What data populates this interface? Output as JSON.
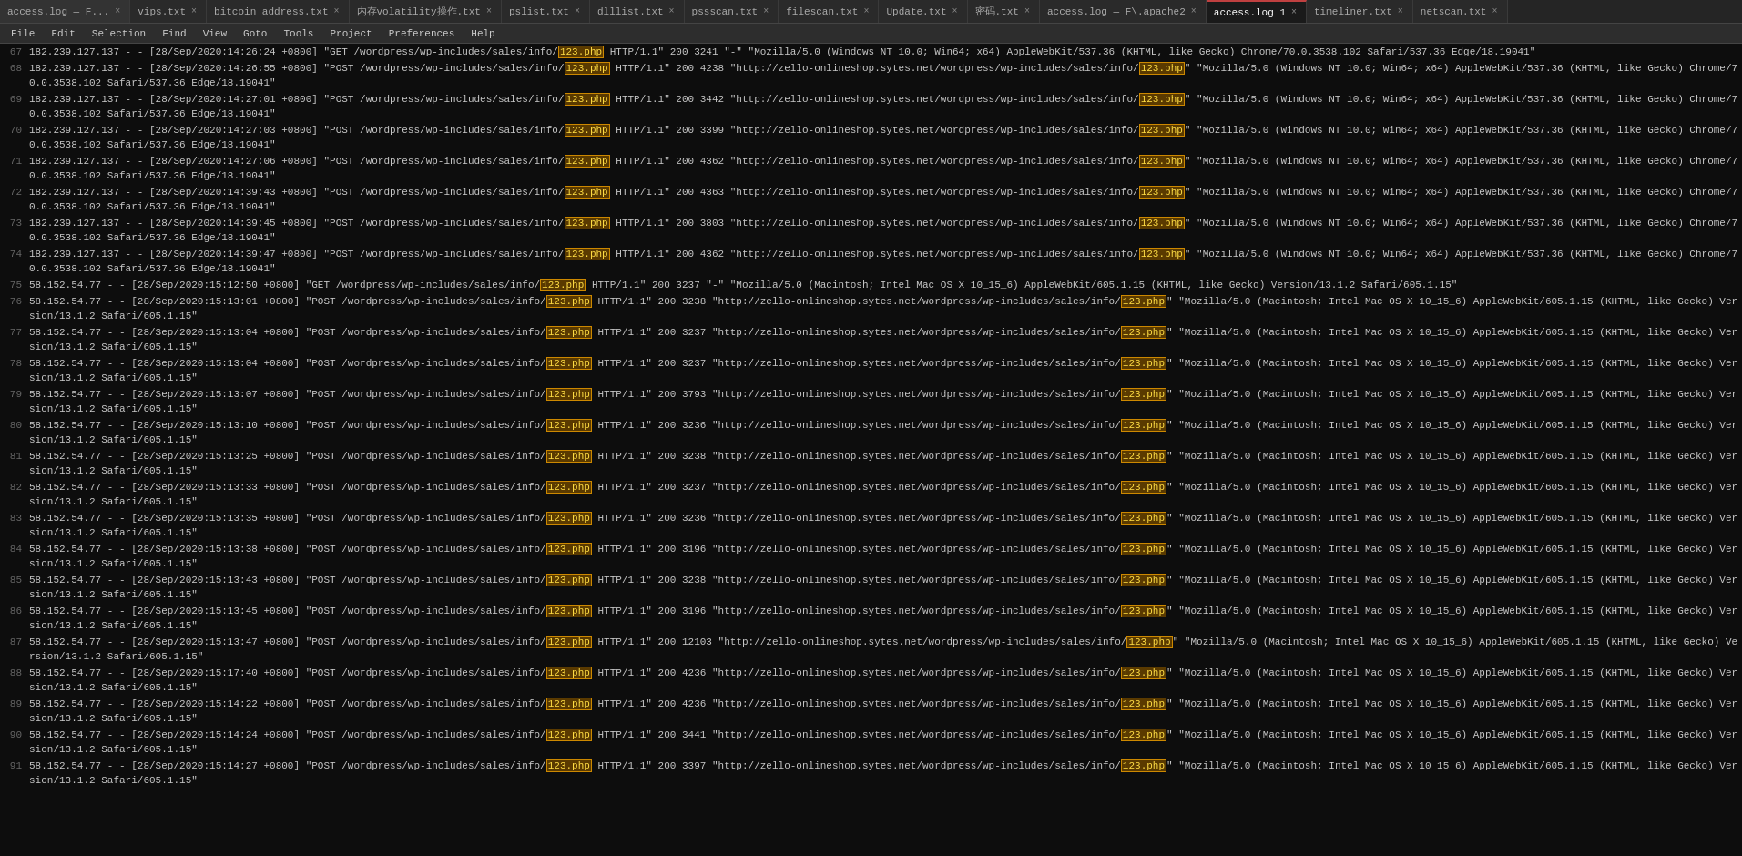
{
  "tabs": [
    {
      "id": "access-log",
      "label": "access.log — F...",
      "active": false,
      "closable": true
    },
    {
      "id": "vips",
      "label": "vips.txt",
      "active": false,
      "closable": true
    },
    {
      "id": "bitcoin",
      "label": "bitcoin_address.txt",
      "active": false,
      "closable": true
    },
    {
      "id": "volatility",
      "label": "内存volatility操作.txt",
      "active": false,
      "closable": true
    },
    {
      "id": "pslist",
      "label": "pslist.txt",
      "active": false,
      "closable": true
    },
    {
      "id": "dlllist",
      "label": "dlllist.txt",
      "active": false,
      "closable": true
    },
    {
      "id": "pssscan",
      "label": "pssscan.txt",
      "active": false,
      "closable": true
    },
    {
      "id": "filescan",
      "label": "filescan.txt",
      "active": false,
      "closable": true
    },
    {
      "id": "update",
      "label": "Update.txt",
      "active": false,
      "closable": true
    },
    {
      "id": "mima",
      "label": "密码.txt",
      "active": false,
      "closable": true
    },
    {
      "id": "access-log-apache2",
      "label": "access.log — F\\.apache2",
      "active": false,
      "closable": true
    },
    {
      "id": "access-log-1",
      "label": "access.log 1",
      "active": true,
      "closable": true
    },
    {
      "id": "timeliner",
      "label": "timeliner.txt",
      "active": false,
      "closable": true
    },
    {
      "id": "netscan",
      "label": "netscan.txt",
      "active": false,
      "closable": true
    }
  ],
  "menu": {
    "items": [
      "File",
      "Edit",
      "Selection",
      "Find",
      "View",
      "Goto",
      "Tools",
      "Project",
      "Preferences",
      "Help"
    ]
  },
  "log": {
    "php_highlight": "123.php",
    "lines": [
      {
        "num": 67,
        "content": "182.239.127.137 - - [28/Sep/2020:14:26:24 +0800] \"GET /wordpress/wp-includes/sales/info/",
        "highlight": "123.php",
        "after": " HTTP/1.1\" 200 3241 \"-\" \"Mozilla/5.0 (Windows NT 10.0; Win64; x64) AppleWebKit/537.36 (KHTML, like Gecko) Chrome/70.0.3538.102 Safari/537.36 Edge/18.19041\""
      },
      {
        "num": 68,
        "content": "182.239.127.137 - - [28/Sep/2020:14:26:55 +0800] \"POST /wordpress/wp-includes/sales/info/",
        "highlight": "123.php",
        "after": " HTTP/1.1\" 200 4238 \"http://zello-onlineshop.sytes.net/wordpress/wp-includes/sales/info/",
        "highlight2": "123.php",
        "after2": "\" \"Mozilla/5.0 (Windows NT 10.0; Win64; x64) AppleWebKit/537.36 (KHTML, like Gecko) Chrome/70.0.3538.102 Safari/537.36 Edge/18.19041\""
      },
      {
        "num": 69,
        "content": "182.239.127.137 - - [28/Sep/2020:14:27:01 +0800] \"POST /wordpress/wp-includes/sales/info/",
        "highlight": "123.php",
        "after": " HTTP/1.1\" 200 3442 \"http://zello-onlineshop.sytes.net/wordpress/wp-includes/sales/info/",
        "highlight2": "123.php",
        "after2": "\" \"Mozilla/5.0 (Windows NT 10.0; Win64; x64) AppleWebKit/537.36 (KHTML, like Gecko) Chrome/70.0.3538.102 Safari/537.36 Edge/18.19041\""
      },
      {
        "num": 70,
        "content": "182.239.127.137 - - [28/Sep/2020:14:27:03 +0800] \"POST /wordpress/wp-includes/sales/info/",
        "highlight": "123.php",
        "after": " HTTP/1.1\" 200 3399 \"http://zello-onlineshop.sytes.net/wordpress/wp-includes/sales/info/",
        "highlight2": "123.php",
        "after2": "\" \"Mozilla/5.0 (Windows NT 10.0; Win64; x64) AppleWebKit/537.36 (KHTML, like Gecko) Chrome/70.0.3538.102 Safari/537.36 Edge/18.19041\""
      },
      {
        "num": 71,
        "content": "182.239.127.137 - - [28/Sep/2020:14:27:06 +0800] \"POST /wordpress/wp-includes/sales/info/",
        "highlight": "123.php",
        "after": " HTTP/1.1\" 200 4362 \"http://zello-onlineshop.sytes.net/wordpress/wp-includes/sales/info/",
        "highlight2": "123.php",
        "after2": "\" \"Mozilla/5.0 (Windows NT 10.0; Win64; x64) AppleWebKit/537.36 (KHTML, like Gecko) Chrome/70.0.3538.102 Safari/537.36 Edge/18.19041\""
      },
      {
        "num": 72,
        "content": "182.239.127.137 - - [28/Sep/2020:14:39:43 +0800] \"POST /wordpress/wp-includes/sales/info/",
        "highlight": "123.php",
        "after": " HTTP/1.1\" 200 4363 \"http://zello-onlineshop.sytes.net/wordpress/wp-includes/sales/info/",
        "highlight2": "123.php",
        "after2": "\" \"Mozilla/5.0 (Windows NT 10.0; Win64; x64) AppleWebKit/537.36 (KHTML, like Gecko) Chrome/70.0.3538.102 Safari/537.36 Edge/18.19041\""
      },
      {
        "num": 73,
        "content": "182.239.127.137 - - [28/Sep/2020:14:39:45 +0800] \"POST /wordpress/wp-includes/sales/info/",
        "highlight": "123.php",
        "after": " HTTP/1.1\" 200 3803 \"http://zello-onlineshop.sytes.net/wordpress/wp-includes/sales/info/",
        "highlight2": "123.php",
        "after2": "\" \"Mozilla/5.0 (Windows NT 10.0; Win64; x64) AppleWebKit/537.36 (KHTML, like Gecko) Chrome/70.0.3538.102 Safari/537.36 Edge/18.19041\""
      },
      {
        "num": 74,
        "content": "182.239.127.137 - - [28/Sep/2020:14:39:47 +0800] \"POST /wordpress/wp-includes/sales/info/",
        "highlight": "123.php",
        "after": " HTTP/1.1\" 200 4362 \"http://zello-onlineshop.sytes.net/wordpress/wp-includes/sales/info/",
        "highlight2": "123.php",
        "after2": "\" \"Mozilla/5.0 (Windows NT 10.0; Win64; x64) AppleWebKit/537.36 (KHTML, like Gecko) Chrome/70.0.3538.102 Safari/537.36 Edge/18.19041\""
      },
      {
        "num": 75,
        "content": "58.152.54.77 - - [28/Sep/2020:15:12:50 +0800] \"GET /wordpress/wp-includes/sales/info/",
        "highlight": "123.php",
        "after": " HTTP/1.1\" 200 3237 \"-\" \"Mozilla/5.0 (Macintosh; Intel Mac OS X 10_15_6) AppleWebKit/605.1.15 (KHTML, like Gecko) Version/13.1.2 Safari/605.1.15\""
      },
      {
        "num": 76,
        "content": "58.152.54.77 - - [28/Sep/2020:15:13:01 +0800] \"POST /wordpress/wp-includes/sales/info/",
        "highlight": "123.php",
        "after": " HTTP/1.1\" 200 3238 \"http://zello-onlineshop.sytes.net/wordpress/wp-includes/sales/info/",
        "highlight2": "123.php",
        "after2": "\" \"Mozilla/5.0 (Macintosh; Intel Mac OS X 10_15_6) AppleWebKit/605.1.15 (KHTML, like Gecko) Version/13.1.2 Safari/605.1.15\""
      },
      {
        "num": 77,
        "content": "58.152.54.77 - - [28/Sep/2020:15:13:04 +0800] \"POST /wordpress/wp-includes/sales/info/",
        "highlight": "123.php",
        "after": " HTTP/1.1\" 200 3237 \"http://zello-onlineshop.sytes.net/wordpress/wp-includes/sales/info/",
        "highlight2": "123.php",
        "after2": "\" \"Mozilla/5.0 (Macintosh; Intel Mac OS X 10_15_6) AppleWebKit/605.1.15 (KHTML, like Gecko) Version/13.1.2 Safari/605.1.15\""
      },
      {
        "num": 78,
        "content": "58.152.54.77 - - [28/Sep/2020:15:13:04 +0800] \"POST /wordpress/wp-includes/sales/info/",
        "highlight": "123.php",
        "after": " HTTP/1.1\" 200 3237 \"http://zello-onlineshop.sytes.net/wordpress/wp-includes/sales/info/",
        "highlight2": "123.php",
        "after2": "\" \"Mozilla/5.0 (Macintosh; Intel Mac OS X 10_15_6) AppleWebKit/605.1.15 (KHTML, like Gecko) Version/13.1.2 Safari/605.1.15\""
      },
      {
        "num": 79,
        "content": "58.152.54.77 - - [28/Sep/2020:15:13:07 +0800] \"POST /wordpress/wp-includes/sales/info/",
        "highlight": "123.php",
        "after": " HTTP/1.1\" 200 3793 \"http://zello-onlineshop.sytes.net/wordpress/wp-includes/sales/info/",
        "highlight2": "123.php",
        "after2": "\" \"Mozilla/5.0 (Macintosh; Intel Mac OS X 10_15_6) AppleWebKit/605.1.15 (KHTML, like Gecko) Version/13.1.2 Safari/605.1.15\""
      },
      {
        "num": 80,
        "content": "58.152.54.77 - - [28/Sep/2020:15:13:10 +0800] \"POST /wordpress/wp-includes/sales/info/",
        "highlight": "123.php",
        "after": " HTTP/1.1\" 200 3236 \"http://zello-onlineshop.sytes.net/wordpress/wp-includes/sales/info/",
        "highlight2": "123.php",
        "after2": "\" \"Mozilla/5.0 (Macintosh; Intel Mac OS X 10_15_6) AppleWebKit/605.1.15 (KHTML, like Gecko) Version/13.1.2 Safari/605.1.15\""
      },
      {
        "num": 81,
        "content": "58.152.54.77 - - [28/Sep/2020:15:13:25 +0800] \"POST /wordpress/wp-includes/sales/info/",
        "highlight": "123.php",
        "after": " HTTP/1.1\" 200 3238 \"http://zello-onlineshop.sytes.net/wordpress/wp-includes/sales/info/",
        "highlight2": "123.php",
        "after2": "\" \"Mozilla/5.0 (Macintosh; Intel Mac OS X 10_15_6) AppleWebKit/605.1.15 (KHTML, like Gecko) Version/13.1.2 Safari/605.1.15\""
      },
      {
        "num": 82,
        "content": "58.152.54.77 - - [28/Sep/2020:15:13:33 +0800] \"POST /wordpress/wp-includes/sales/info/",
        "highlight": "123.php",
        "after": " HTTP/1.1\" 200 3237 \"http://zello-onlineshop.sytes.net/wordpress/wp-includes/sales/info/",
        "highlight2": "123.php",
        "after2": "\" \"Mozilla/5.0 (Macintosh; Intel Mac OS X 10_15_6) AppleWebKit/605.1.15 (KHTML, like Gecko) Version/13.1.2 Safari/605.1.15\""
      },
      {
        "num": 83,
        "content": "58.152.54.77 - - [28/Sep/2020:15:13:35 +0800] \"POST /wordpress/wp-includes/sales/info/",
        "highlight": "123.php",
        "after": " HTTP/1.1\" 200 3236 \"http://zello-onlineshop.sytes.net/wordpress/wp-includes/sales/info/",
        "highlight2": "123.php",
        "after2": "\" \"Mozilla/5.0 (Macintosh; Intel Mac OS X 10_15_6) AppleWebKit/605.1.15 (KHTML, like Gecko) Version/13.1.2 Safari/605.1.15\""
      },
      {
        "num": 84,
        "content": "58.152.54.77 - - [28/Sep/2020:15:13:38 +0800] \"POST /wordpress/wp-includes/sales/info/",
        "highlight": "123.php",
        "after": " HTTP/1.1\" 200 3196 \"http://zello-onlineshop.sytes.net/wordpress/wp-includes/sales/info/",
        "highlight2": "123.php",
        "after2": "\" \"Mozilla/5.0 (Macintosh; Intel Mac OS X 10_15_6) AppleWebKit/605.1.15 (KHTML, like Gecko) Version/13.1.2 Safari/605.1.15\""
      },
      {
        "num": 85,
        "content": "58.152.54.77 - - [28/Sep/2020:15:13:43 +0800] \"POST /wordpress/wp-includes/sales/info/",
        "highlight": "123.php",
        "after": " HTTP/1.1\" 200 3238 \"http://zello-onlineshop.sytes.net/wordpress/wp-includes/sales/info/",
        "highlight2": "123.php",
        "after2": "\" \"Mozilla/5.0 (Macintosh; Intel Mac OS X 10_15_6) AppleWebKit/605.1.15 (KHTML, like Gecko) Version/13.1.2 Safari/605.1.15\""
      },
      {
        "num": 86,
        "content": "58.152.54.77 - - [28/Sep/2020:15:13:45 +0800] \"POST /wordpress/wp-includes/sales/info/",
        "highlight": "123.php",
        "after": " HTTP/1.1\" 200 3196 \"http://zello-onlineshop.sytes.net/wordpress/wp-includes/sales/info/",
        "highlight2": "123.php",
        "after2": "\" \"Mozilla/5.0 (Macintosh; Intel Mac OS X 10_15_6) AppleWebKit/605.1.15 (KHTML, like Gecko) Version/13.1.2 Safari/605.1.15\""
      },
      {
        "num": 87,
        "content": "58.152.54.77 - - [28/Sep/2020:15:13:47 +0800] \"POST /wordpress/wp-includes/sales/info/",
        "highlight": "123.php",
        "after": " HTTP/1.1\" 200 12103 \"http://zello-onlineshop.sytes.net/wordpress/wp-includes/sales/info/",
        "highlight2": "123.php",
        "after2": "\" \"Mozilla/5.0 (Macintosh; Intel Mac OS X 10_15_6) AppleWebKit/605.1.15 (KHTML, like Gecko) Version/13.1.2 Safari/605.1.15\""
      },
      {
        "num": 88,
        "content": "58.152.54.77 - - [28/Sep/2020:15:17:40 +0800] \"POST /wordpress/wp-includes/sales/info/",
        "highlight": "123.php",
        "after": " HTTP/1.1\" 200 4236 \"http://zello-onlineshop.sytes.net/wordpress/wp-includes/sales/info/",
        "highlight2": "123.php",
        "after2": "\" \"Mozilla/5.0 (Macintosh; Intel Mac OS X 10_15_6) AppleWebKit/605.1.15 (KHTML, like Gecko) Version/13.1.2 Safari/605.1.15\""
      },
      {
        "num": 89,
        "content": "58.152.54.77 - - [28/Sep/2020:15:14:22 +0800] \"POST /wordpress/wp-includes/sales/info/",
        "highlight": "123.php",
        "after": " HTTP/1.1\" 200 4236 \"http://zello-onlineshop.sytes.net/wordpress/wp-includes/sales/info/",
        "highlight2": "123.php",
        "after2": "\" \"Mozilla/5.0 (Macintosh; Intel Mac OS X 10_15_6) AppleWebKit/605.1.15 (KHTML, like Gecko) Version/13.1.2 Safari/605.1.15\""
      },
      {
        "num": 90,
        "content": "58.152.54.77 - - [28/Sep/2020:15:14:24 +0800] \"POST /wordpress/wp-includes/sales/info/",
        "highlight": "123.php",
        "after": " HTTP/1.1\" 200 3441 \"http://zello-onlineshop.sytes.net/wordpress/wp-includes/sales/info/",
        "highlight2": "123.php",
        "after2": "\" \"Mozilla/5.0 (Macintosh; Intel Mac OS X 10_15_6) AppleWebKit/605.1.15 (KHTML, like Gecko) Version/13.1.2 Safari/605.1.15\""
      },
      {
        "num": 91,
        "content": "58.152.54.77 - - [28/Sep/2020:15:14:27 +0800] \"POST /wordpress/wp-includes/sales/info/",
        "highlight": "123.php",
        "after": " HTTP/1.1\" 200 3397 \"http://zello-onlineshop.sytes.net/wordpress/wp-includes/sales/info/",
        "highlight2": "123.php",
        "after2": "\" \"Mozilla/5.0 (Macintosh; Intel Mac OS X 10_15_6) AppleWebKit/605.1.15 (KHTML, like Gecko) Version/13.1.2 Safari/605.1.15\""
      }
    ]
  }
}
